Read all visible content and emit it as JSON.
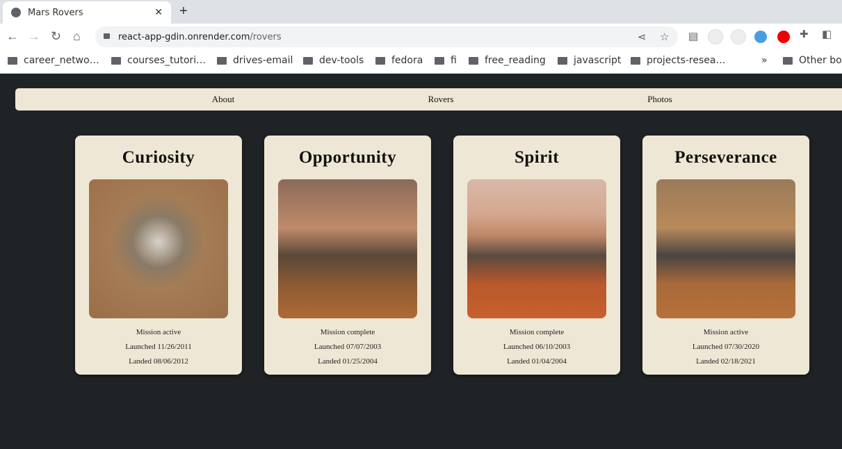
{
  "browser": {
    "tab_title": "Mars Rovers",
    "url_host": "react-app-gdin.onrender.com",
    "url_path": "/rovers",
    "bookmarks": [
      "career_netwo…",
      "courses_tutori…",
      "drives-email",
      "dev-tools",
      "fedora",
      "fi",
      "free_reading",
      "javascript",
      "projects-resea…"
    ],
    "other_bookmarks": "Other boo"
  },
  "nav": {
    "items": [
      "About",
      "Rovers",
      "Photos"
    ]
  },
  "rovers": [
    {
      "name": "Curiosity",
      "status": "Mission active",
      "launched": "Launched 11/26/2011",
      "landed": "Landed 08/06/2012"
    },
    {
      "name": "Opportunity",
      "status": "Mission complete",
      "launched": "Launched 07/07/2003",
      "landed": "Landed 01/25/2004"
    },
    {
      "name": "Spirit",
      "status": "Mission complete",
      "launched": "Launched 06/10/2003",
      "landed": "Landed 01/04/2004"
    },
    {
      "name": "Perseverance",
      "status": "Mission active",
      "launched": "Launched 07/30/2020",
      "landed": "Landed 02/18/2021"
    }
  ],
  "colors": {
    "page_bg": "#202326",
    "card_bg": "#efe7d5"
  }
}
